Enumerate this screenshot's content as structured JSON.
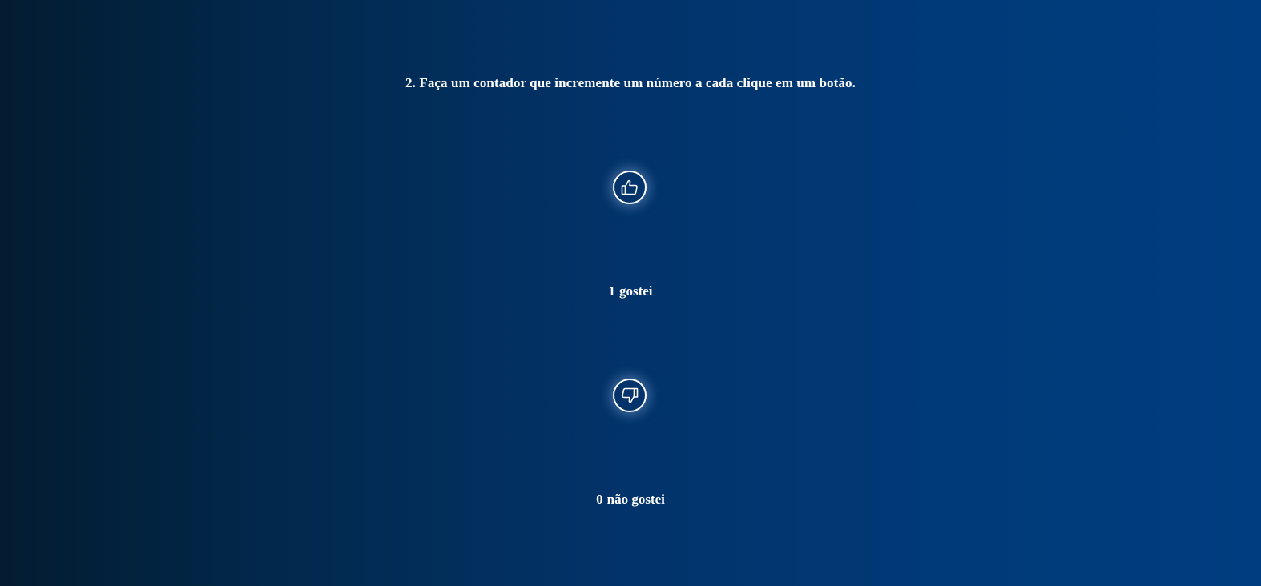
{
  "heading": "2. Faça um contador que incremente um número a cada clique em um botão.",
  "like": {
    "icon": "thumbs-up-icon",
    "count": "1",
    "label": "gostei"
  },
  "dislike": {
    "icon": "thumbs-down-icon",
    "count": "0",
    "label": "não gostei"
  },
  "colors": {
    "background_left": "#031c31",
    "background_right": "#003d80",
    "text": "#ffffff",
    "button_border": "#ffffff"
  }
}
